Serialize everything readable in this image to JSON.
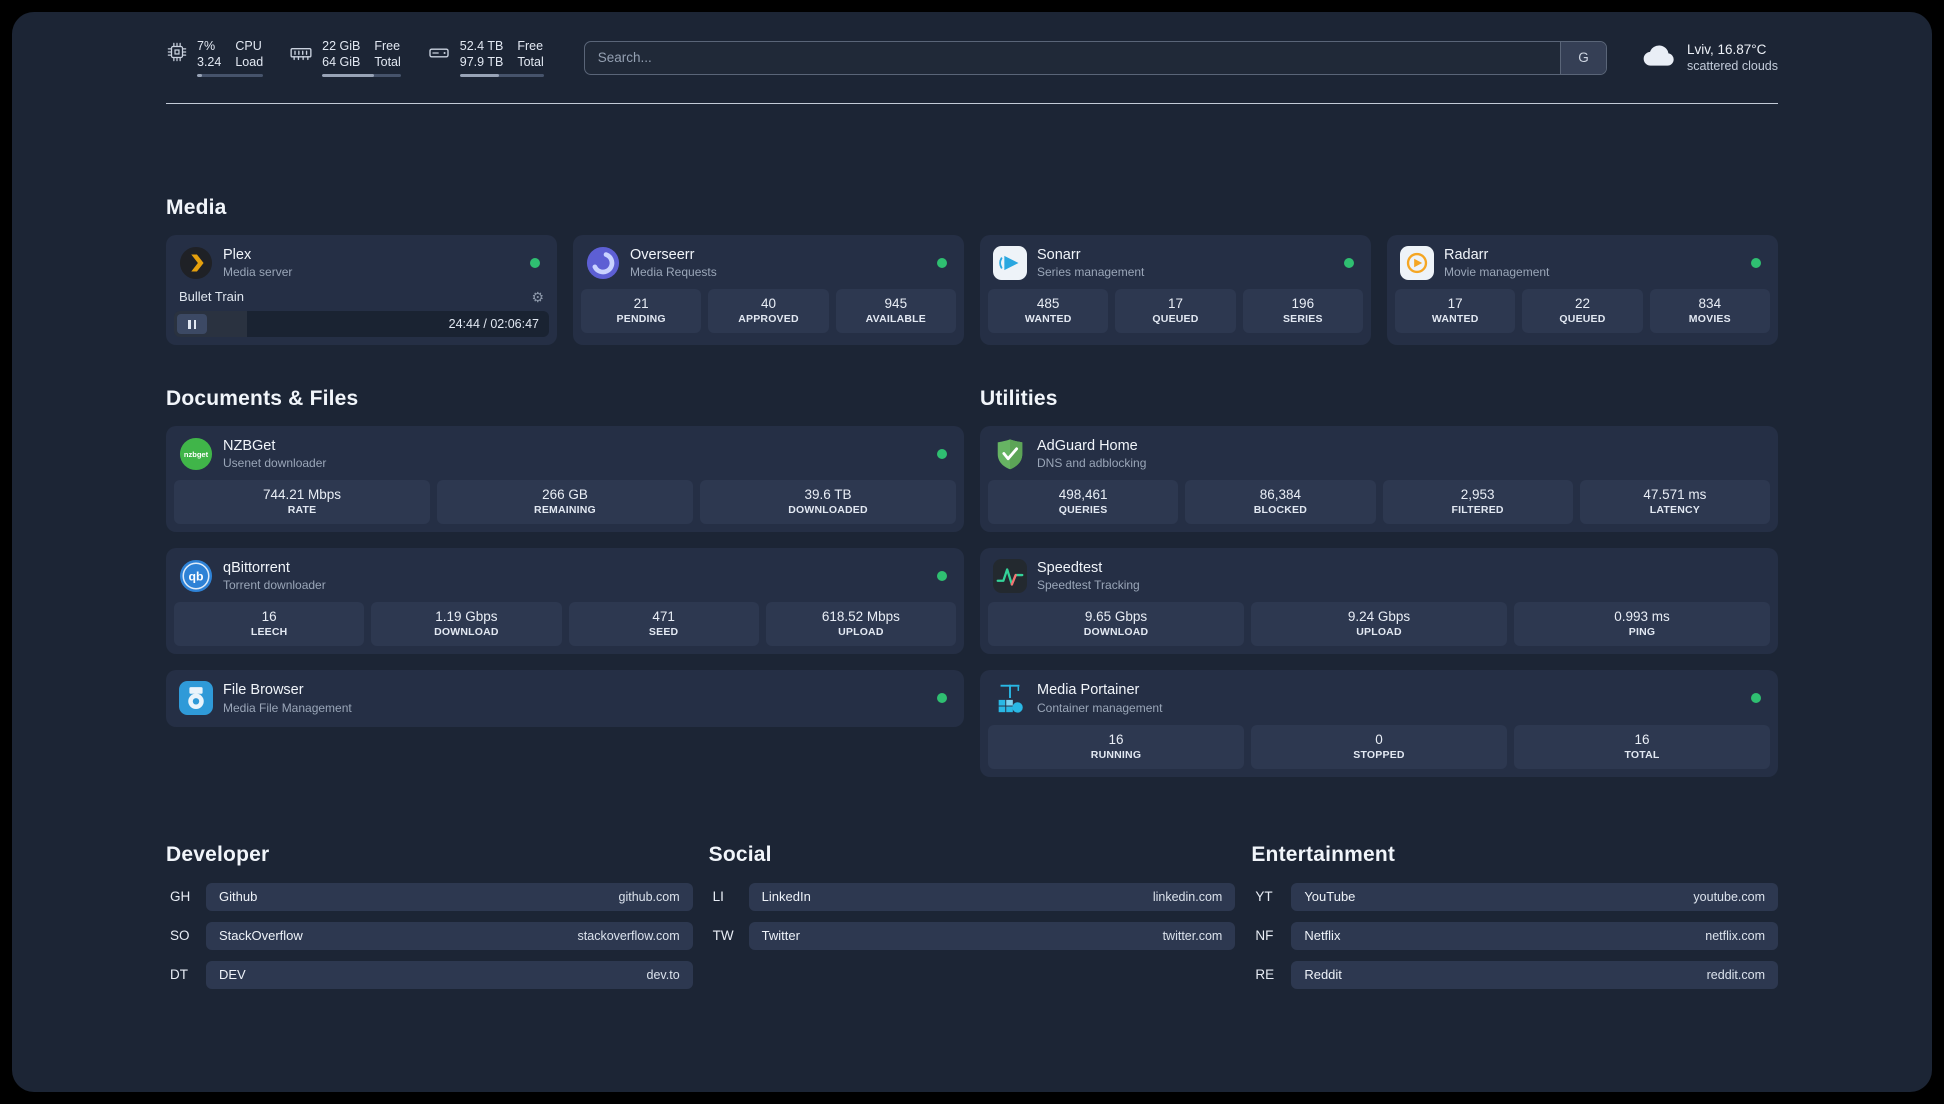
{
  "theme": {
    "background": "#1c2535",
    "card": "#252f45",
    "tile": "#2d3850",
    "status_green": "#2fbf71",
    "text_primary": "#eef2f8",
    "text_secondary": "#9aa6b8"
  },
  "topbar": {
    "cpu": {
      "value_top": "7%",
      "value_bottom": "3.24",
      "label_top": "CPU",
      "label_bottom": "Load",
      "progress_pct": 7
    },
    "memory": {
      "value_top": "22 GiB",
      "value_bottom": "64 GiB",
      "label_top": "Free",
      "label_bottom": "Total",
      "progress_pct": 66
    },
    "disk": {
      "value_top": "52.4 TB",
      "value_bottom": "97.9 TB",
      "label_top": "Free",
      "label_bottom": "Total",
      "progress_pct": 47
    },
    "search": {
      "placeholder": "Search...",
      "button_label": "G"
    },
    "weather": {
      "location": "Lviv, 16.87°C",
      "condition": "scattered clouds"
    }
  },
  "media": {
    "title": "Media",
    "plex": {
      "name": "Plex",
      "subtitle": "Media server",
      "now_playing": "Bullet Train",
      "time": "24:44 / 02:06:47",
      "progress_pct": 19.5
    },
    "overseerr": {
      "name": "Overseerr",
      "subtitle": "Media Requests",
      "stats": [
        {
          "value": "21",
          "label": "PENDING"
        },
        {
          "value": "40",
          "label": "APPROVED"
        },
        {
          "value": "945",
          "label": "AVAILABLE"
        }
      ]
    },
    "sonarr": {
      "name": "Sonarr",
      "subtitle": "Series management",
      "stats": [
        {
          "value": "485",
          "label": "WANTED"
        },
        {
          "value": "17",
          "label": "QUEUED"
        },
        {
          "value": "196",
          "label": "SERIES"
        }
      ]
    },
    "radarr": {
      "name": "Radarr",
      "subtitle": "Movie management",
      "stats": [
        {
          "value": "17",
          "label": "WANTED"
        },
        {
          "value": "22",
          "label": "QUEUED"
        },
        {
          "value": "834",
          "label": "MOVIES"
        }
      ]
    }
  },
  "documents": {
    "title": "Documents & Files",
    "nzbget": {
      "name": "NZBGet",
      "subtitle": "Usenet downloader",
      "stats": [
        {
          "value": "744.21 Mbps",
          "label": "RATE"
        },
        {
          "value": "266 GB",
          "label": "REMAINING"
        },
        {
          "value": "39.6 TB",
          "label": "DOWNLOADED"
        }
      ]
    },
    "qbittorrent": {
      "name": "qBittorrent",
      "subtitle": "Torrent downloader",
      "stats": [
        {
          "value": "16",
          "label": "LEECH"
        },
        {
          "value": "1.19 Gbps",
          "label": "DOWNLOAD"
        },
        {
          "value": "471",
          "label": "SEED"
        },
        {
          "value": "618.52 Mbps",
          "label": "UPLOAD"
        }
      ]
    },
    "filebrowser": {
      "name": "File Browser",
      "subtitle": "Media File Management"
    }
  },
  "utilities": {
    "title": "Utilities",
    "adguard": {
      "name": "AdGuard Home",
      "subtitle": "DNS and adblocking",
      "stats": [
        {
          "value": "498,461",
          "label": "QUERIES"
        },
        {
          "value": "86,384",
          "label": "BLOCKED"
        },
        {
          "value": "2,953",
          "label": "FILTERED"
        },
        {
          "value": "47.571 ms",
          "label": "LATENCY"
        }
      ]
    },
    "speedtest": {
      "name": "Speedtest",
      "subtitle": "Speedtest Tracking",
      "stats": [
        {
          "value": "9.65 Gbps",
          "label": "DOWNLOAD"
        },
        {
          "value": "9.24 Gbps",
          "label": "UPLOAD"
        },
        {
          "value": "0.993 ms",
          "label": "PING"
        }
      ]
    },
    "portainer": {
      "name": "Media Portainer",
      "subtitle": "Container management",
      "stats": [
        {
          "value": "16",
          "label": "RUNNING"
        },
        {
          "value": "0",
          "label": "STOPPED"
        },
        {
          "value": "16",
          "label": "TOTAL"
        }
      ]
    }
  },
  "bookmarks": {
    "developer": {
      "title": "Developer",
      "items": [
        {
          "abbr": "GH",
          "name": "Github",
          "domain": "github.com"
        },
        {
          "abbr": "SO",
          "name": "StackOverflow",
          "domain": "stackoverflow.com"
        },
        {
          "abbr": "DT",
          "name": "DEV",
          "domain": "dev.to"
        }
      ]
    },
    "social": {
      "title": "Social",
      "items": [
        {
          "abbr": "LI",
          "name": "LinkedIn",
          "domain": "linkedin.com"
        },
        {
          "abbr": "TW",
          "name": "Twitter",
          "domain": "twitter.com"
        }
      ]
    },
    "entertainment": {
      "title": "Entertainment",
      "items": [
        {
          "abbr": "YT",
          "name": "YouTube",
          "domain": "youtube.com"
        },
        {
          "abbr": "NF",
          "name": "Netflix",
          "domain": "netflix.com"
        },
        {
          "abbr": "RE",
          "name": "Reddit",
          "domain": "reddit.com"
        }
      ]
    }
  }
}
